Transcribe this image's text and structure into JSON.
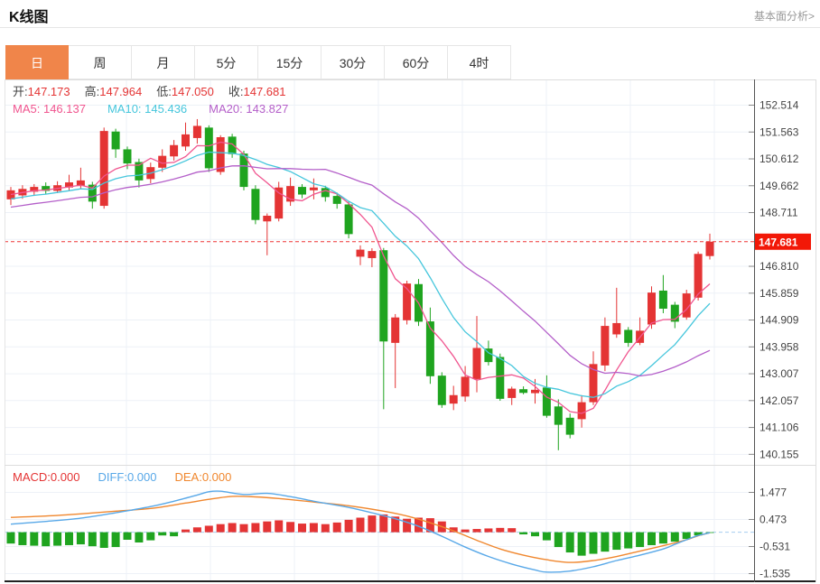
{
  "header": {
    "title": "K线图",
    "link": "基本面分析>"
  },
  "tabs": [
    {
      "key": "day",
      "label": "日",
      "active": true
    },
    {
      "key": "week",
      "label": "周",
      "active": false
    },
    {
      "key": "month",
      "label": "月",
      "active": false
    },
    {
      "key": "5min",
      "label": "5分",
      "active": false
    },
    {
      "key": "15min",
      "label": "15分",
      "active": false
    },
    {
      "key": "30min",
      "label": "30分",
      "active": false
    },
    {
      "key": "60min",
      "label": "60分",
      "active": false
    },
    {
      "key": "4hour",
      "label": "4时",
      "active": false
    }
  ],
  "main_legend": {
    "label_color": "#444444",
    "value_color": "#e43434",
    "items": [
      {
        "label": "开:",
        "value": "147.173"
      },
      {
        "label": "高:",
        "value": "147.964"
      },
      {
        "label": "低:",
        "value": "147.050"
      },
      {
        "label": "收:",
        "value": "147.681"
      }
    ]
  },
  "ma_legend": {
    "items": [
      {
        "label": "MA5:",
        "value": "146.137",
        "color": "#f0558f"
      },
      {
        "label": "MA10:",
        "value": "145.436",
        "color": "#45c6dc"
      },
      {
        "label": "MA20:",
        "value": "143.827",
        "color": "#b45fc9"
      }
    ]
  },
  "macd_legend": {
    "items": [
      {
        "label": "MACD:",
        "value": "0.000",
        "color": "#e43434"
      },
      {
        "label": "DIFF:",
        "value": "0.000",
        "color": "#58a8e8"
      },
      {
        "label": "DEA:",
        "value": "0.000",
        "color": "#f0872e"
      }
    ]
  },
  "price_axis": {
    "ticks": [
      "152.514",
      "151.563",
      "150.612",
      "149.662",
      "148.711",
      "146.810",
      "145.859",
      "144.909",
      "143.958",
      "143.007",
      "142.057",
      "141.106",
      "140.155"
    ],
    "badge": "147.681"
  },
  "macd_axis": {
    "ticks": [
      "1.477",
      "0.473",
      "-0.531",
      "-1.535"
    ]
  },
  "colors": {
    "up": "#e43434",
    "down": "#1fa41f",
    "ma5": "#f0558f",
    "ma10": "#45c6dc",
    "ma20": "#b45fc9",
    "diff": "#58a8e8",
    "dea": "#f0872e",
    "price_line": "#ee3333",
    "badge_bg": "#f21807",
    "badge_text": "#ffffff",
    "macd_zero": "#a6cdf0",
    "grid": "#edf1f7",
    "axis_line": "#555555",
    "axis_text": "#444444",
    "tab_active_bg": "#f0854a",
    "tab_active_text": "#ffffff"
  },
  "chart_data": {
    "type": "candlestick_with_macd",
    "period": "日",
    "ylim_price": [
      140.155,
      152.514
    ],
    "ylim_macd": [
      -1.535,
      1.477
    ],
    "current_price": 147.681,
    "price_grid": [
      152.514,
      151.563,
      150.612,
      149.662,
      148.711,
      147.76,
      146.81,
      145.859,
      144.909,
      143.958,
      143.007,
      142.057,
      141.106,
      140.155
    ],
    "macd_grid": [
      1.477,
      0.473,
      -0.531,
      -1.535
    ],
    "candles": [
      [
        149.18,
        149.62,
        148.98,
        149.5
      ],
      [
        149.32,
        149.68,
        149.2,
        149.55
      ],
      [
        149.45,
        149.72,
        149.3,
        149.62
      ],
      [
        149.65,
        149.78,
        149.38,
        149.48
      ],
      [
        149.48,
        149.82,
        149.4,
        149.68
      ],
      [
        149.6,
        150.05,
        149.5,
        149.78
      ],
      [
        149.65,
        150.3,
        149.55,
        149.85
      ],
      [
        149.7,
        149.8,
        148.85,
        149.1
      ],
      [
        148.95,
        151.72,
        148.85,
        151.6
      ],
      [
        151.58,
        151.68,
        150.65,
        150.95
      ],
      [
        150.95,
        151.05,
        150.25,
        150.45
      ],
      [
        150.5,
        150.62,
        149.6,
        149.85
      ],
      [
        149.9,
        150.48,
        149.75,
        150.32
      ],
      [
        150.3,
        150.95,
        150.15,
        150.72
      ],
      [
        150.7,
        151.28,
        150.55,
        151.1
      ],
      [
        151.05,
        151.9,
        150.9,
        151.48
      ],
      [
        151.35,
        152.02,
        151.15,
        151.78
      ],
      [
        151.72,
        151.8,
        150.15,
        150.28
      ],
      [
        150.15,
        151.45,
        150.05,
        151.38
      ],
      [
        151.4,
        151.5,
        150.65,
        150.78
      ],
      [
        150.8,
        150.9,
        149.5,
        149.62
      ],
      [
        149.55,
        149.68,
        148.3,
        148.45
      ],
      [
        148.4,
        148.68,
        147.2,
        148.6
      ],
      [
        148.5,
        149.8,
        148.4,
        149.6
      ],
      [
        149.1,
        149.95,
        148.95,
        149.65
      ],
      [
        149.62,
        149.72,
        149.22,
        149.35
      ],
      [
        149.5,
        149.92,
        149.18,
        149.6
      ],
      [
        149.58,
        149.66,
        149.1,
        149.26
      ],
      [
        149.3,
        149.42,
        148.85,
        149.02
      ],
      [
        149.0,
        149.1,
        147.8,
        147.95
      ],
      [
        147.15,
        147.55,
        146.85,
        147.4
      ],
      [
        147.1,
        147.45,
        146.78,
        147.35
      ],
      [
        147.38,
        147.46,
        141.75,
        144.15
      ],
      [
        144.1,
        145.12,
        142.5,
        145.0
      ],
      [
        144.9,
        146.3,
        144.75,
        146.2
      ],
      [
        146.18,
        146.36,
        144.7,
        144.85
      ],
      [
        144.86,
        145.35,
        142.65,
        142.92
      ],
      [
        142.94,
        143.06,
        141.8,
        141.9
      ],
      [
        141.95,
        142.58,
        141.72,
        142.25
      ],
      [
        142.2,
        143.28,
        142.02,
        142.9
      ],
      [
        142.82,
        145.05,
        142.35,
        143.92
      ],
      [
        143.9,
        144.18,
        143.3,
        143.42
      ],
      [
        143.6,
        143.72,
        142.05,
        142.12
      ],
      [
        142.15,
        142.55,
        141.9,
        142.48
      ],
      [
        142.46,
        142.56,
        142.28,
        142.33
      ],
      [
        142.32,
        142.82,
        141.95,
        142.44
      ],
      [
        142.52,
        142.95,
        141.45,
        141.52
      ],
      [
        141.85,
        142.1,
        140.3,
        141.2
      ],
      [
        141.45,
        141.6,
        140.72,
        140.85
      ],
      [
        141.4,
        142.25,
        141.1,
        142.0
      ],
      [
        142.0,
        143.8,
        141.9,
        143.35
      ],
      [
        143.3,
        145.0,
        143.1,
        144.7
      ],
      [
        144.4,
        146.05,
        144.28,
        144.8
      ],
      [
        144.56,
        144.66,
        143.96,
        144.1
      ],
      [
        144.1,
        145.0,
        144.02,
        144.53
      ],
      [
        144.75,
        146.1,
        144.6,
        145.88
      ],
      [
        145.95,
        146.5,
        145.15,
        145.31
      ],
      [
        145.45,
        145.55,
        144.62,
        144.85
      ],
      [
        145.0,
        145.98,
        144.92,
        145.85
      ],
      [
        145.7,
        147.33,
        145.6,
        147.25
      ],
      [
        147.173,
        147.964,
        147.05,
        147.681
      ]
    ],
    "ma_windows": [
      5,
      10,
      20
    ],
    "ma_seed": [
      148.2,
      148.3,
      148.4,
      148.5,
      148.55,
      148.6,
      148.65,
      148.7,
      148.75,
      148.8,
      148.85,
      148.9,
      149.0,
      149.05,
      149.1,
      149.15,
      149.2,
      149.3,
      149.35,
      149.4
    ],
    "macd_histogram": [
      -0.42,
      -0.48,
      -0.5,
      -0.52,
      -0.5,
      -0.48,
      -0.45,
      -0.52,
      -0.58,
      -0.55,
      -0.28,
      -0.38,
      -0.3,
      -0.12,
      -0.15,
      0.1,
      0.18,
      0.24,
      0.3,
      0.34,
      0.3,
      0.34,
      0.4,
      0.44,
      0.38,
      0.32,
      0.34,
      0.3,
      0.36,
      0.46,
      0.54,
      0.62,
      0.66,
      0.58,
      0.5,
      0.54,
      0.52,
      0.4,
      0.18,
      0.1,
      0.12,
      0.14,
      0.16,
      0.15,
      -0.08,
      -0.15,
      -0.3,
      -0.55,
      -0.75,
      -0.87,
      -0.8,
      -0.72,
      -0.65,
      -0.6,
      -0.55,
      -0.48,
      -0.42,
      -0.35,
      -0.25,
      -0.12,
      -0.02
    ],
    "diff_line": [
      [
        0,
        0.3
      ],
      [
        3,
        0.4
      ],
      [
        6,
        0.52
      ],
      [
        9,
        0.72
      ],
      [
        12,
        0.95
      ],
      [
        14,
        1.15
      ],
      [
        16,
        1.38
      ],
      [
        17,
        1.5
      ],
      [
        18,
        1.52
      ],
      [
        20,
        1.4
      ],
      [
        22,
        1.44
      ],
      [
        24,
        1.32
      ],
      [
        26,
        1.15
      ],
      [
        29,
        0.92
      ],
      [
        31,
        0.72
      ],
      [
        33,
        0.5
      ],
      [
        35,
        0.22
      ],
      [
        37,
        -0.15
      ],
      [
        39,
        -0.55
      ],
      [
        41,
        -0.9
      ],
      [
        43,
        -1.18
      ],
      [
        45,
        -1.4
      ],
      [
        46,
        -1.48
      ],
      [
        48,
        -1.44
      ],
      [
        50,
        -1.28
      ],
      [
        52,
        -1.05
      ],
      [
        54,
        -0.85
      ],
      [
        56,
        -0.62
      ],
      [
        57,
        -0.45
      ],
      [
        58,
        -0.28
      ],
      [
        59,
        -0.12
      ],
      [
        60,
        -0.02
      ]
    ],
    "dea_line": [
      [
        0,
        0.55
      ],
      [
        3,
        0.6
      ],
      [
        6,
        0.68
      ],
      [
        9,
        0.78
      ],
      [
        12,
        0.88
      ],
      [
        15,
        1.08
      ],
      [
        17,
        1.22
      ],
      [
        19,
        1.33
      ],
      [
        21,
        1.31
      ],
      [
        23,
        1.25
      ],
      [
        26,
        1.12
      ],
      [
        29,
        0.98
      ],
      [
        32,
        0.78
      ],
      [
        34,
        0.6
      ],
      [
        36,
        0.35
      ],
      [
        38,
        0.05
      ],
      [
        40,
        -0.3
      ],
      [
        42,
        -0.62
      ],
      [
        44,
        -0.85
      ],
      [
        46,
        -1.02
      ],
      [
        48,
        -1.12
      ],
      [
        50,
        -1.05
      ],
      [
        52,
        -0.9
      ],
      [
        54,
        -0.7
      ],
      [
        56,
        -0.5
      ],
      [
        58,
        -0.28
      ],
      [
        59,
        -0.13
      ],
      [
        60,
        -0.02
      ]
    ]
  }
}
